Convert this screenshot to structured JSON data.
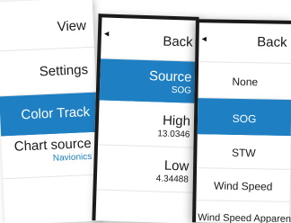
{
  "menu_left": {
    "items": [
      {
        "label": "View"
      },
      {
        "label": "Settings"
      },
      {
        "label": "Color Track",
        "selected": true
      },
      {
        "label": "Chart source",
        "sub": "Navionics"
      }
    ]
  },
  "menu_middle": {
    "back_label": "Back",
    "items": [
      {
        "label": "Source",
        "value": "SOG",
        "selected": true
      },
      {
        "label": "High",
        "value": "13.0346"
      },
      {
        "label": "Low",
        "value": "4.34488"
      }
    ]
  },
  "menu_right": {
    "back_label": "Back",
    "options": [
      {
        "label": "None"
      },
      {
        "label": "SOG",
        "selected": true
      },
      {
        "label": "STW"
      },
      {
        "label": "Wind Speed"
      },
      {
        "label": "Wind Speed Apparent"
      }
    ]
  },
  "icons": {
    "back_chevron": "caret-left-icon"
  },
  "colors": {
    "selection": "#1e7fc3",
    "frame": "#1a1a1a"
  }
}
